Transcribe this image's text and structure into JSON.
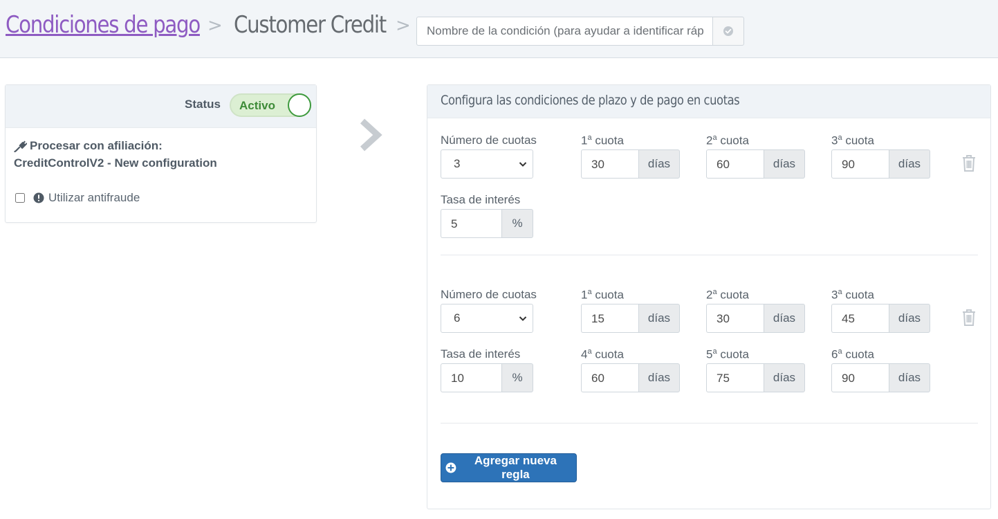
{
  "breadcrumb": {
    "root": "Condiciones de pago",
    "current": "Customer Credit",
    "separator": ">"
  },
  "name_field": {
    "placeholder": "Nombre de la condición (para ayudar a identificar rápidamente)",
    "value": ""
  },
  "status": {
    "label": "Status",
    "toggle_text": "Activo",
    "active": true
  },
  "affiliation": {
    "label": "Procesar con afiliación:",
    "value": "CreditControlV2 - New configuration"
  },
  "antifraud": {
    "label": "Utilizar antifraude",
    "checked": false
  },
  "panel": {
    "title": "Configura las condiciones de plazo y de pago en cuotas"
  },
  "labels": {
    "installments": "Número de cuotas",
    "interest": "Tasa de interés",
    "days_unit": "días",
    "percent_unit": "%",
    "cuota_word": "cuota",
    "ordinal_sup": "a"
  },
  "rules": [
    {
      "installments": "3",
      "interest": "5",
      "cuotas": [
        {
          "n": "1",
          "days": "30"
        },
        {
          "n": "2",
          "days": "60"
        },
        {
          "n": "3",
          "days": "90"
        }
      ]
    },
    {
      "installments": "6",
      "interest": "10",
      "cuotas": [
        {
          "n": "1",
          "days": "15"
        },
        {
          "n": "2",
          "days": "30"
        },
        {
          "n": "3",
          "days": "45"
        },
        {
          "n": "4",
          "days": "60"
        },
        {
          "n": "5",
          "days": "75"
        },
        {
          "n": "6",
          "days": "90"
        }
      ]
    }
  ],
  "add_button": {
    "label": "Agregar nueva regla"
  },
  "colors": {
    "link": "#8e5bc2",
    "primary_button": "#2d73b8",
    "toggle_on": "#3e9a3e",
    "header_bg": "#f2f5f8"
  }
}
